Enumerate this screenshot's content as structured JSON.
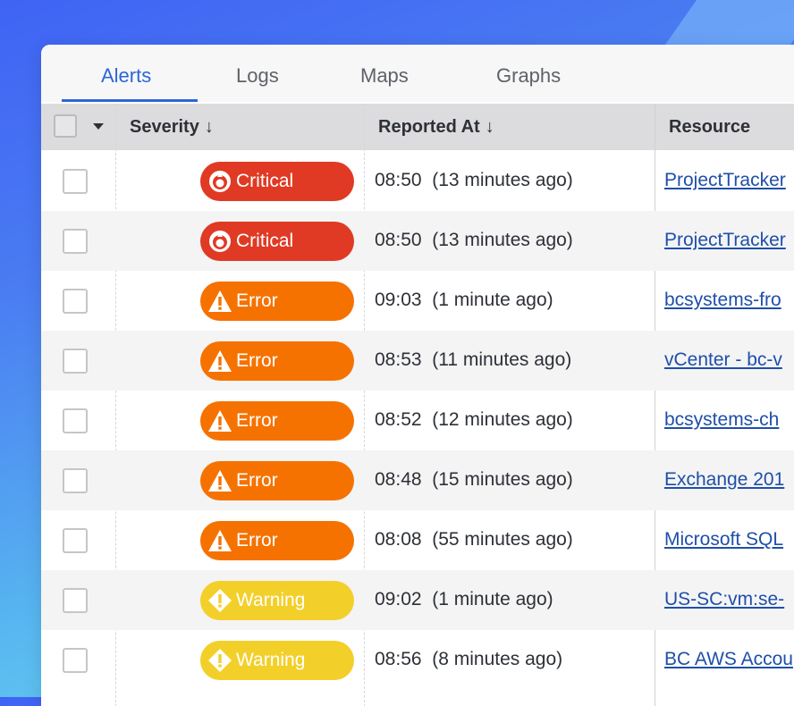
{
  "tabs": [
    {
      "label": "Alerts",
      "active": true
    },
    {
      "label": "Logs",
      "active": false
    },
    {
      "label": "Maps",
      "active": false
    },
    {
      "label": "Graphs",
      "active": false
    }
  ],
  "table": {
    "columns": {
      "severity": "Severity",
      "reported_at": "Reported At",
      "resource": "Resource"
    },
    "rows": [
      {
        "severity": "Critical",
        "time": "08:50  (13 minutes ago)",
        "resource": "ProjectTracker"
      },
      {
        "severity": "Critical",
        "time": "08:50  (13 minutes ago)",
        "resource": "ProjectTracker"
      },
      {
        "severity": "Error",
        "time": "09:03  (1 minute ago)",
        "resource": "bcsystems-fro"
      },
      {
        "severity": "Error",
        "time": "08:53  (11 minutes ago)",
        "resource": "vCenter - bc-v"
      },
      {
        "severity": "Error",
        "time": "08:52  (12 minutes ago)",
        "resource": "bcsystems-ch"
      },
      {
        "severity": "Error",
        "time": "08:48  (15 minutes ago)",
        "resource": "Exchange 201"
      },
      {
        "severity": "Error",
        "time": "08:08  (55 minutes ago)",
        "resource": "Microsoft SQL"
      },
      {
        "severity": "Warning",
        "time": "09:02  (1 minute ago)",
        "resource": "US-SC:vm:se-"
      },
      {
        "severity": "Warning",
        "time": "08:56  (8 minutes ago)",
        "resource": "BC AWS Accou"
      }
    ]
  },
  "colors": {
    "accent": "#2d66d6",
    "critical": "#e03a24",
    "error": "#f57200",
    "warning": "#f3cf2a",
    "link": "#1f4fa8"
  },
  "icons": {
    "sort": "arrow-down-icon",
    "critical": "critical-flame-icon",
    "error": "warning-triangle-icon",
    "warning": "warning-diamond-icon"
  }
}
